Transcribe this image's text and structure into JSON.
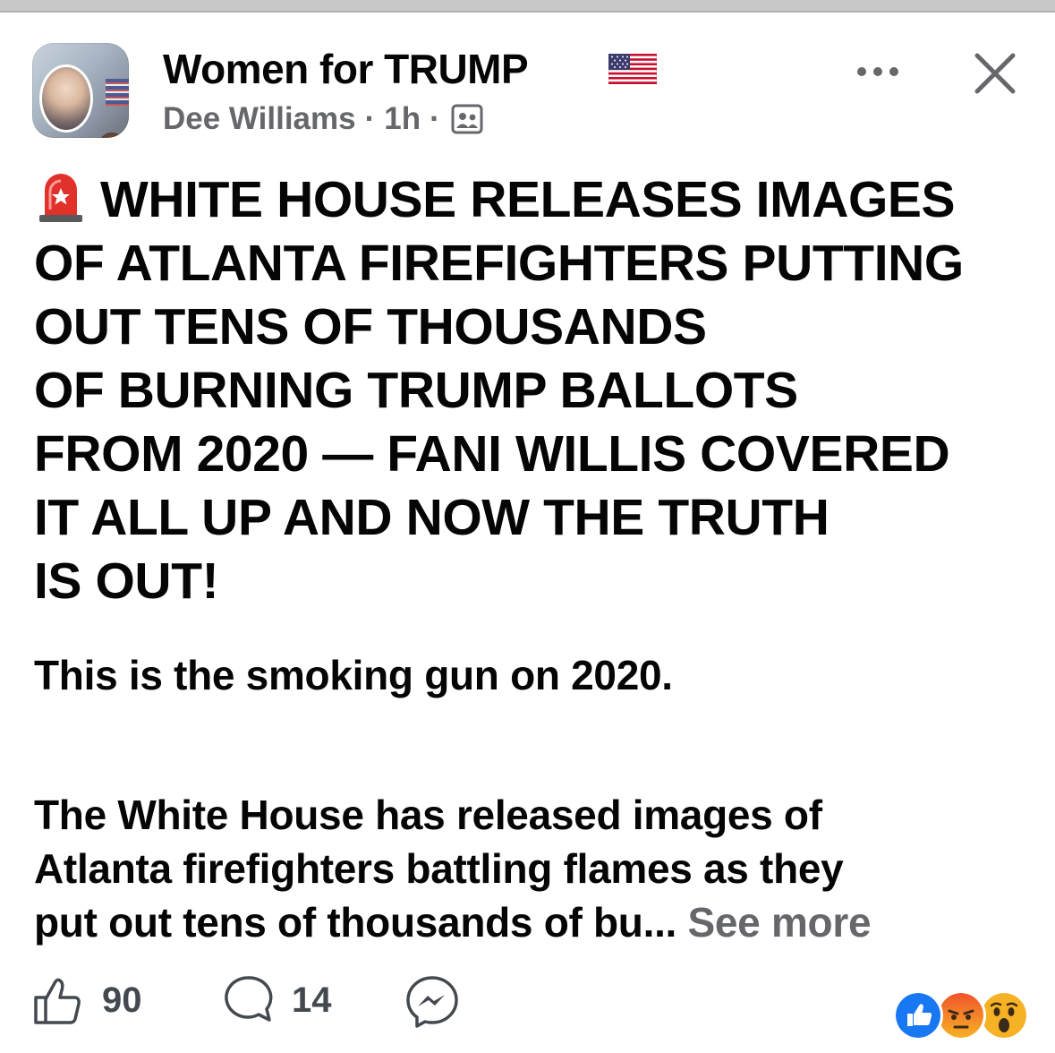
{
  "post": {
    "group_name": "Women for TRUMP",
    "author": "Dee Williams",
    "time": "1h",
    "separator": "·",
    "headline_lines": [
      "WHITE HOUSE RELEASES IMAGES",
      "OF ATLANTA FIREFIGHTERS PUTTING",
      "OUT TENS OF THOUSANDS",
      "OF BURNING TRUMP BALLOTS",
      "FROM 2020 — FANI WILLIS COVERED",
      "IT ALL UP AND NOW THE TRUTH",
      "IS OUT!"
    ],
    "paragraph1": "This is the smoking gun on 2020.",
    "paragraph2_lines": [
      "The White House has released images of",
      "Atlanta firefighters battling flames as they",
      "put out tens of thousands of bu..."
    ],
    "see_more": "See more"
  },
  "actions": {
    "likes": "90",
    "comments": "14"
  },
  "icons": {
    "flag": "us-flag-icon",
    "audience": "group-members-icon",
    "more": "more-options-icon",
    "close": "close-icon",
    "siren": "police-light-icon",
    "like": "thumbs-up-icon",
    "comment": "comment-bubble-icon",
    "share": "messenger-icon",
    "reactions": [
      "like-reaction-icon",
      "angry-reaction-icon",
      "wow-reaction-icon"
    ]
  },
  "colors": {
    "text": "#050505",
    "secondary": "#65676b",
    "like_blue": "#1877f2",
    "angry_red": "#e9710f",
    "wow_yellow": "#f7b125"
  }
}
